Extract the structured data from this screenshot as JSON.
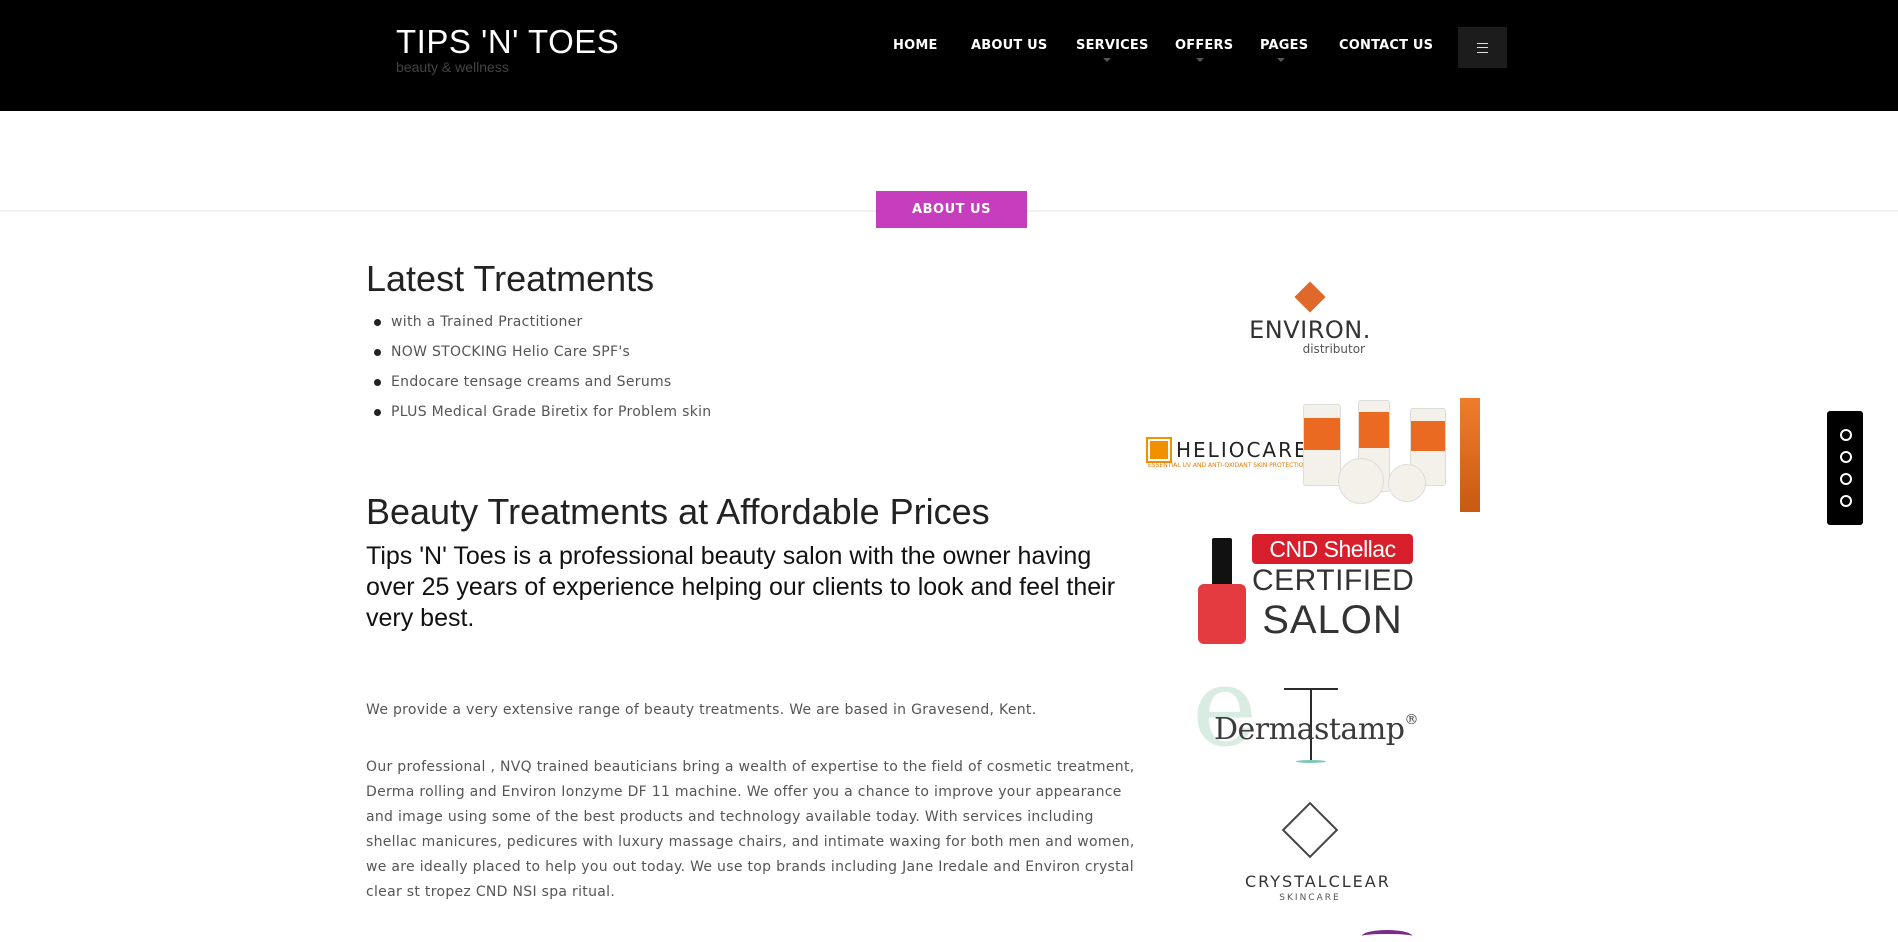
{
  "header": {
    "brand_title": "TIPS 'N' TOES",
    "brand_tagline": "beauty & wellness",
    "nav": [
      {
        "label": "HOME",
        "dropdown": false
      },
      {
        "label": "ABOUT US",
        "dropdown": false
      },
      {
        "label": "SERVICES",
        "dropdown": true
      },
      {
        "label": "OFFERS",
        "dropdown": true
      },
      {
        "label": "PAGES",
        "dropdown": true
      },
      {
        "label": "CONTACT US",
        "dropdown": false
      }
    ],
    "menu_icon": "hamburger-icon"
  },
  "section_tab": {
    "label": "ABOUT US",
    "color": "#c63dbd"
  },
  "main": {
    "latest_heading": "Latest Treatments",
    "latest_items": [
      "with a Trained Practitioner",
      "NOW STOCKING Helio Care SPF's",
      "Endocare tensage creams and Serums",
      "PLUS Medical Grade Biretix for Problem skin"
    ],
    "beauty_heading": "Beauty Treatments at Affordable Prices",
    "lead": "Tips 'N' Toes is a professional beauty salon with the owner having over 25 years of experience helping our clients to look and feel their very best.",
    "paragraph_1": "We provide a very extensive range of beauty treatments. We are based in Gravesend, Kent.",
    "paragraph_2": "Our professional , NVQ trained beauticians bring a wealth of expertise to the field of cosmetic treatment, Derma rolling and Environ Ionzyme DF 11 machine. We offer you a chance to improve your appearance and image using some of the best products and technology available today. With services including shellac manicures, pedicures with luxury massage chairs, and intimate waxing for both men and women, we are ideally placed to help you out today. We use top brands including Jane Iredale and Environ crystal clear st tropez CND NSI spa ritual."
  },
  "logos": {
    "environ": {
      "name": "ENVIRON.",
      "sub": "distributor"
    },
    "heliocare": {
      "name": "HELIOCARE",
      "tagline": "ESSENTIAL UV AND ANTI-OXIDANT SKIN PROTECTION"
    },
    "cnd": {
      "badge": "CND Shellac",
      "line1": "CERTIFIED",
      "line2": "SALON"
    },
    "dermastamp": {
      "name": "Dermastamp",
      "reg": "®"
    },
    "crystalclear": {
      "name": "CRYSTALCLEAR",
      "sub": "SKINCARE"
    }
  },
  "dot_nav": {
    "count": 4,
    "icon": "circle-outline-icon"
  }
}
